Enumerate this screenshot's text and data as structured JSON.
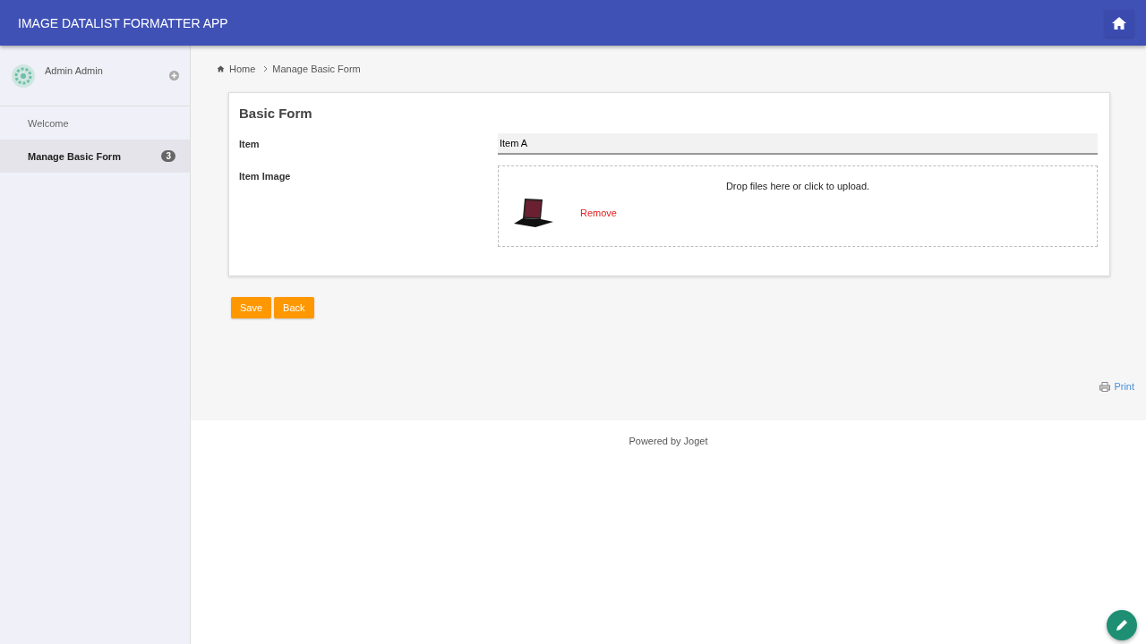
{
  "header": {
    "title": "IMAGE DATALIST FORMATTER APP"
  },
  "sidebar": {
    "user": "Admin Admin",
    "items": [
      {
        "label": "Welcome",
        "selected": false
      },
      {
        "label": "Manage Basic Form",
        "selected": true,
        "badge": "3"
      }
    ]
  },
  "breadcrumb": [
    "Home",
    "Manage Basic Form"
  ],
  "form": {
    "title": "Basic Form",
    "item_label": "Item",
    "item_value": "Item A",
    "image_label": "Item Image",
    "upload_hint": "Drop files here or click to upload.",
    "remove": "Remove"
  },
  "buttons": [
    "Save",
    "Back"
  ],
  "print": "Print",
  "footer": "Powered by Joget"
}
